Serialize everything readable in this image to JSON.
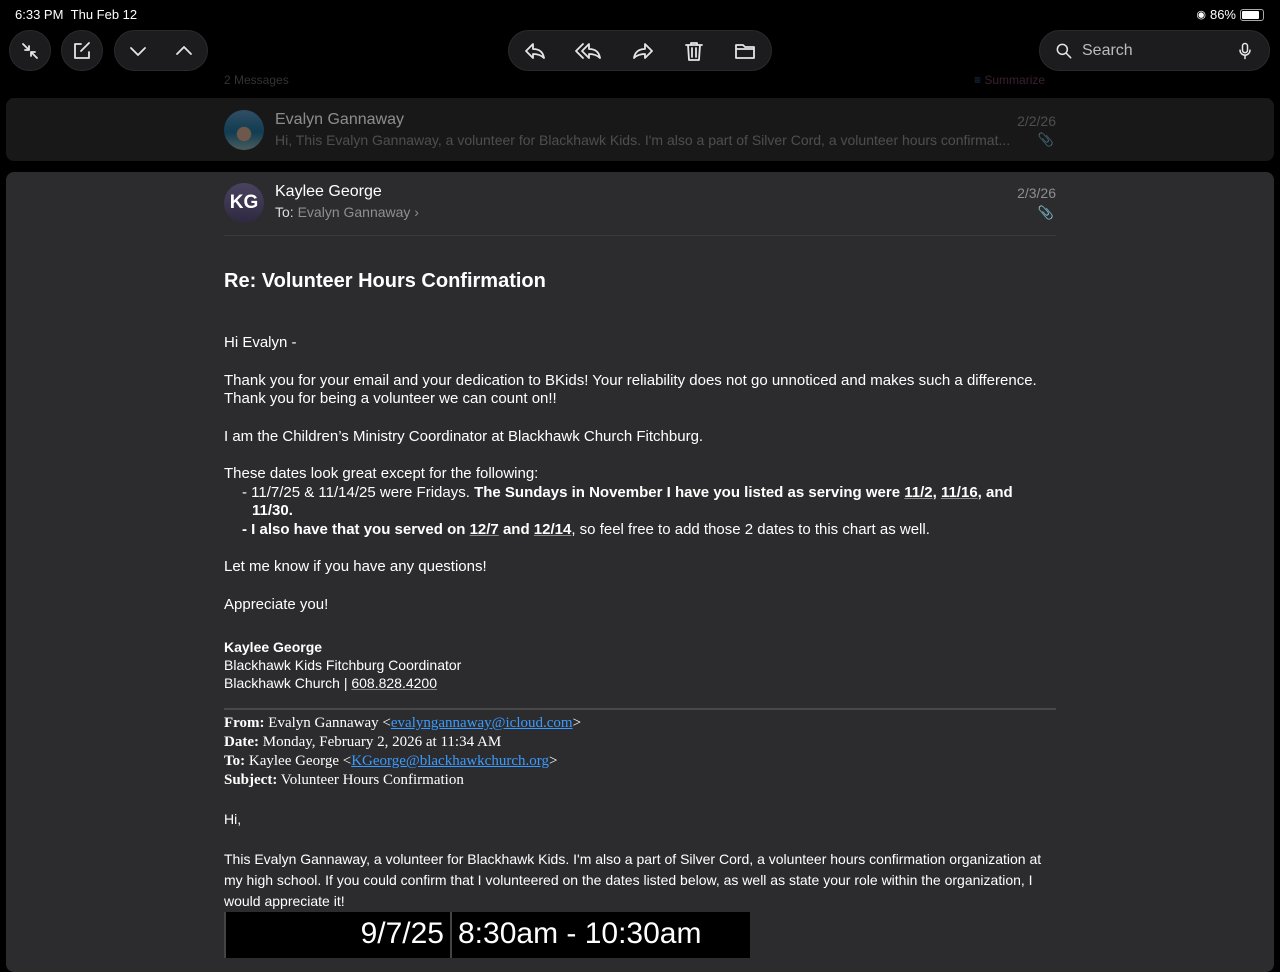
{
  "status": {
    "time": "6:33 PM",
    "date": "Thu Feb 12",
    "battery": "86%"
  },
  "toolbar": {
    "search_placeholder": "Search"
  },
  "thread": {
    "count": "2 Messages",
    "summarize": "Summarize"
  },
  "messages": [
    {
      "sender": "Evalyn Gannaway",
      "date": "2/2/26",
      "preview": "Hi, This Evalyn Gannaway, a volunteer for Blackhawk Kids. I'm also a part of Silver Cord, a volunteer hours confirmat..."
    },
    {
      "sender": "Kaylee George",
      "initials": "KG",
      "date": "2/3/26",
      "to_label": "To:",
      "to": "Evalyn Gannaway"
    }
  ],
  "email": {
    "subject": "Re: Volunteer Hours Confirmation",
    "greeting": "Hi Evalyn -",
    "p1": "Thank you for your email and your dedication to BKids! Your reliability does not go unnoticed and makes such a difference. Thank you for being a volunteer we can count on!!",
    "p2": "I am the Children’s Ministry Coordinator at Blackhawk Church Fitchburg.",
    "p3": "These dates look great except for the following:",
    "b1a": "- 11/7/25 & 11/14/25 were Fridays. ",
    "b1b": "The Sundays in November I have you listed as serving were ",
    "b1c": "11/2",
    "b1d": ", ",
    "b1e": "11/16",
    "b1f": ", and 11/30.",
    "b2a": "- I also have that you served on ",
    "b2b": "12/7",
    "b2c": " and ",
    "b2d": "12/14",
    "b2e": ", so feel free to add those 2 dates to this chart as well.",
    "p4": "Let me know if you have any questions!",
    "p5": "Appreciate you!",
    "sig_name": "Kaylee George",
    "sig_title": "Blackhawk Kids Fitchburg Coordinator",
    "sig_org": "Blackhawk Church | ",
    "sig_phone": "608.828.4200",
    "q_from_l": "From:",
    "q_from": " Evalyn Gannaway <",
    "q_from_email": "evalyngannaway@icloud.com",
    "q_date_l": "Date:",
    "q_date": " Monday, February 2, 2026 at 11:34 AM",
    "q_to_l": "To:",
    "q_to": " Kaylee George <",
    "q_to_email": "KGeorge@blackhawkchurch.org",
    "q_subj_l": "Subject:",
    "q_subj": " Volunteer Hours Confirmation",
    "q_hi": "Hi,",
    "q_body": "This Evalyn Gannaway, a volunteer for Blackhawk Kids. I'm also a part of Silver Cord, a volunteer hours confirmation organization at my high school. If you could confirm that I volunteered on the dates listed below, as well as state your role within the organization, I would appreciate it!",
    "table": [
      {
        "date": "9/7/25",
        "time": "8:30am - 10:30am"
      }
    ]
  }
}
